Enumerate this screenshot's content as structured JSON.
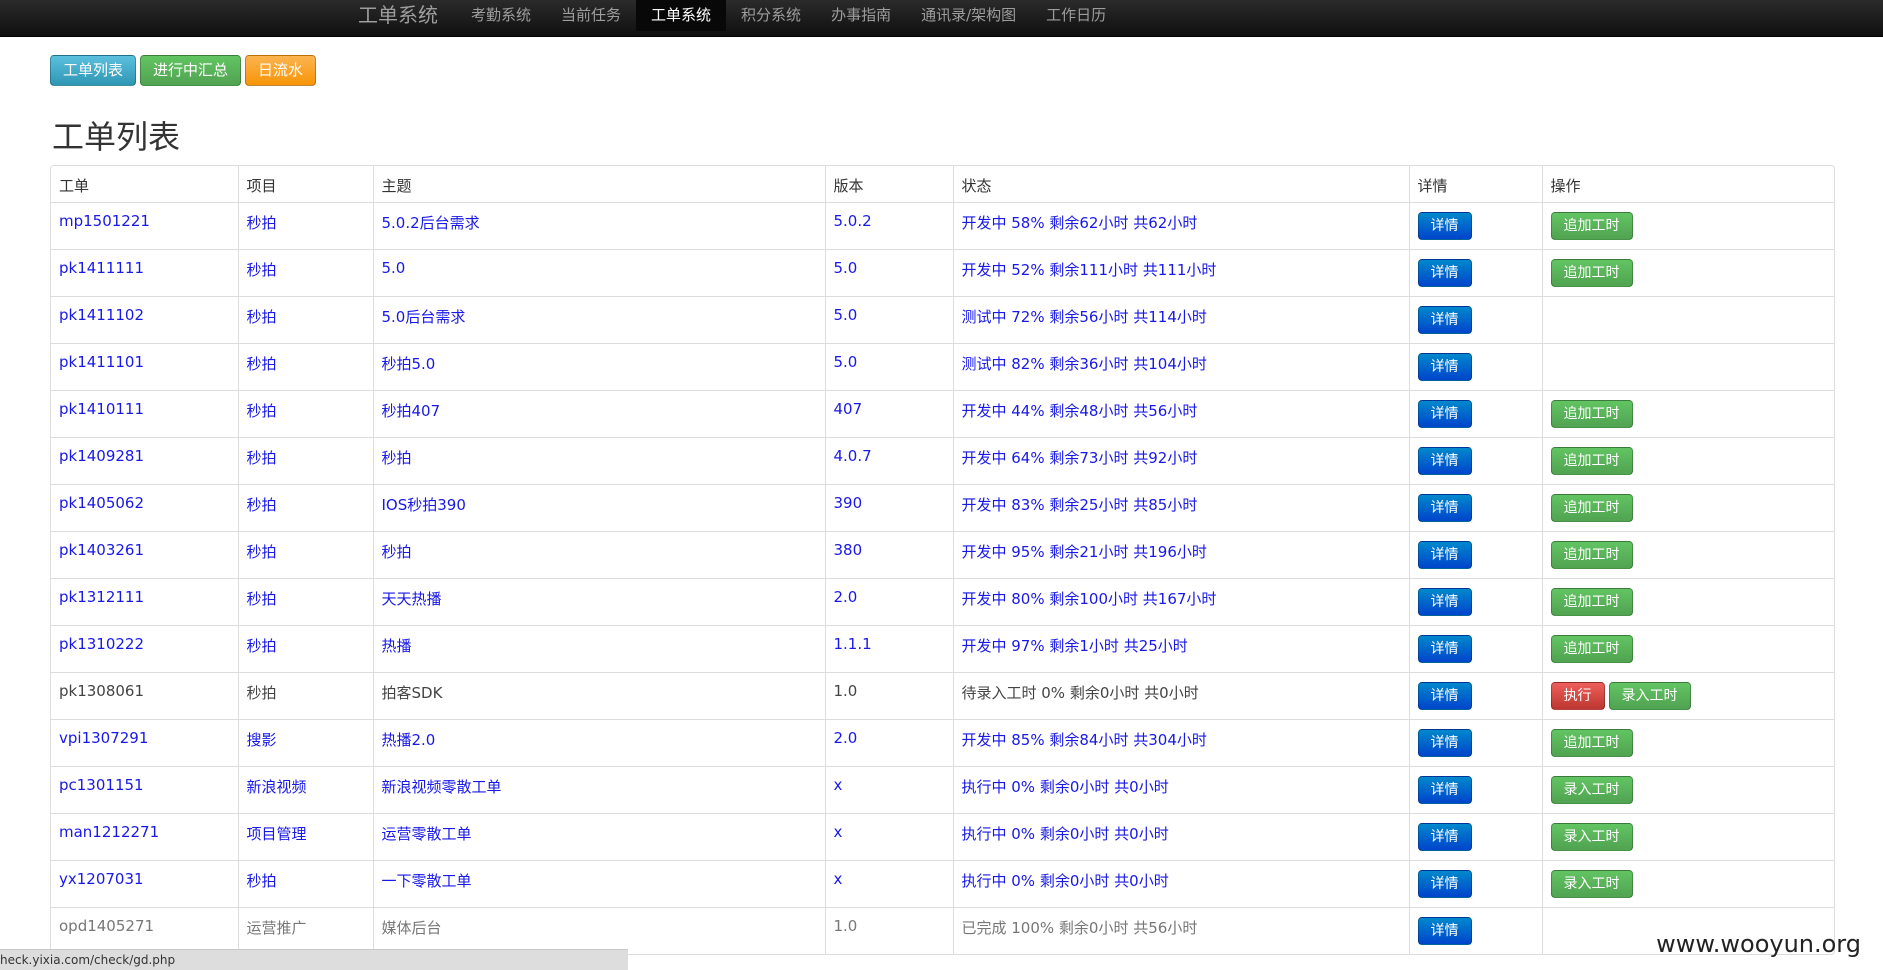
{
  "nav": {
    "brand": "工单系统",
    "items": [
      {
        "label": "考勤系统",
        "active": false
      },
      {
        "label": "当前任务",
        "active": false
      },
      {
        "label": "工单系统",
        "active": true
      },
      {
        "label": "积分系统",
        "active": false
      },
      {
        "label": "办事指南",
        "active": false
      },
      {
        "label": "通讯录/架构图",
        "active": false
      },
      {
        "label": "工作日历",
        "active": false
      }
    ]
  },
  "toolbar": {
    "list_label": "工单列表",
    "summary_label": "进行中汇总",
    "daily_label": "日流水"
  },
  "page_title": "工单列表",
  "table": {
    "headers": [
      "工单",
      "项目",
      "主题",
      "版本",
      "状态",
      "详情",
      "操作"
    ],
    "detail_label": "详情",
    "rows": [
      {
        "id": "mp1501221",
        "project": "秒拍",
        "topic": "5.0.2后台需求",
        "version": "5.0.2",
        "status": "开发中 58% 剩余62小时 共62小时",
        "style": "link",
        "actions": [
          "追加工时"
        ]
      },
      {
        "id": "pk1411111",
        "project": "秒拍",
        "topic": "5.0",
        "version": "5.0",
        "status": "开发中 52% 剩余111小时 共111小时",
        "style": "link",
        "actions": [
          "追加工时"
        ]
      },
      {
        "id": "pk1411102",
        "project": "秒拍",
        "topic": "5.0后台需求",
        "version": "5.0",
        "status": "测试中 72% 剩余56小时 共114小时",
        "style": "link",
        "actions": []
      },
      {
        "id": "pk1411101",
        "project": "秒拍",
        "topic": "秒拍5.0",
        "version": "5.0",
        "status": "测试中 82% 剩余36小时 共104小时",
        "style": "link",
        "actions": []
      },
      {
        "id": "pk1410111",
        "project": "秒拍",
        "topic": "秒拍407",
        "version": "407",
        "status": "开发中 44% 剩余48小时 共56小时",
        "style": "link",
        "actions": [
          "追加工时"
        ]
      },
      {
        "id": "pk1409281",
        "project": "秒拍",
        "topic": "秒拍",
        "version": "4.0.7",
        "status": "开发中 64% 剩余73小时 共92小时",
        "style": "link",
        "actions": [
          "追加工时"
        ]
      },
      {
        "id": "pk1405062",
        "project": "秒拍",
        "topic": "IOS秒拍390",
        "version": "390",
        "status": "开发中 83% 剩余25小时 共85小时",
        "style": "link",
        "actions": [
          "追加工时"
        ]
      },
      {
        "id": "pk1403261",
        "project": "秒拍",
        "topic": "秒拍",
        "version": "380",
        "status": "开发中 95% 剩余21小时 共196小时",
        "style": "link",
        "actions": [
          "追加工时"
        ]
      },
      {
        "id": "pk1312111",
        "project": "秒拍",
        "topic": "天天热播",
        "version": "2.0",
        "status": "开发中 80% 剩余100小时 共167小时",
        "style": "link",
        "actions": [
          "追加工时"
        ]
      },
      {
        "id": "pk1310222",
        "project": "秒拍",
        "topic": "热播",
        "version": "1.1.1",
        "status": "开发中 97% 剩余1小时 共25小时",
        "style": "link",
        "actions": [
          "追加工时"
        ]
      },
      {
        "id": "pk1308061",
        "project": "秒拍",
        "topic": "拍客SDK",
        "version": "1.0",
        "status": "待录入工时 0% 剩余0小时 共0小时",
        "style": "plain",
        "actions": [
          "执行",
          "录入工时"
        ]
      },
      {
        "id": "vpi1307291",
        "project": "搜影",
        "topic": "热播2.0",
        "version": "2.0",
        "status": "开发中 85% 剩余84小时 共304小时",
        "style": "link",
        "actions": [
          "追加工时"
        ]
      },
      {
        "id": "pc1301151",
        "project": "新浪视频",
        "topic": "新浪视频零散工单",
        "version": "x",
        "status": "执行中 0% 剩余0小时 共0小时",
        "style": "link",
        "actions": [
          "录入工时"
        ]
      },
      {
        "id": "man1212271",
        "project": "项目管理",
        "topic": "运营零散工单",
        "version": "x",
        "status": "执行中 0% 剩余0小时 共0小时",
        "style": "link",
        "actions": [
          "录入工时"
        ]
      },
      {
        "id": "yx1207031",
        "project": "秒拍",
        "topic": "一下零散工单",
        "version": "x",
        "status": "执行中 0% 剩余0小时 共0小时",
        "style": "link",
        "actions": [
          "录入工时"
        ]
      },
      {
        "id": "opd1405271",
        "project": "运营推广",
        "topic": "媒体后台",
        "version": "1.0",
        "status": "已完成 100% 剩余0小时 共56小时",
        "style": "grey",
        "actions": []
      }
    ]
  },
  "statusbar": "heck.yixia.com/check/gd.php",
  "watermark": "www.wooyun.org"
}
